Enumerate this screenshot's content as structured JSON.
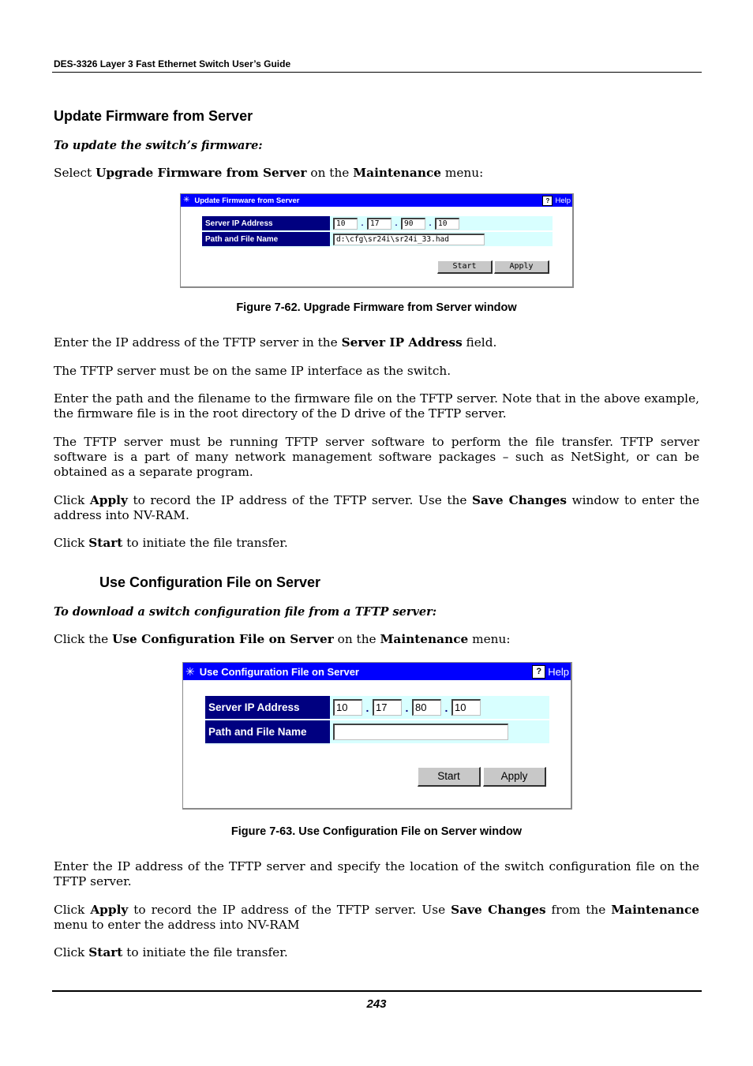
{
  "running_header": "DES-3326 Layer 3 Fast Ethernet Switch User’s Guide",
  "page_number": "243",
  "section1": {
    "heading": "Update Firmware from Server",
    "subheading": "To update the switch’s firmware:",
    "intro": {
      "p1": "Select ",
      "b1": "Upgrade Firmware from Server",
      "p2": " on the ",
      "b2": "Maintenance",
      "p3": " menu:"
    },
    "window": {
      "title": "Update Firmware from Server",
      "title_icon": "network-icon",
      "help_label": "Help",
      "help_icon": "question-icon",
      "rows": [
        {
          "label": "Server IP Address",
          "ip": [
            "10",
            "17",
            "90",
            "10"
          ]
        },
        {
          "label": "Path and File Name",
          "value": "d:\\cfg\\sr24i\\sr24i_33.had"
        }
      ],
      "ip_separator": ".",
      "buttons": {
        "start": "Start",
        "apply": "Apply"
      }
    },
    "caption": "Figure 7-62.  Upgrade Firmware from Server window",
    "paragraphs": {
      "a": {
        "p1": "Enter the IP address of the TFTP server in the ",
        "b1": "Server IP Address",
        "p2": " field."
      },
      "b": "The TFTP server must be on the same IP interface as the switch.",
      "c": "Enter the path and the filename to the firmware file on the TFTP server. Note that in the above example, the firmware file is in the root directory of the D drive of the TFTP server.",
      "d": "The TFTP server must be running TFTP server software to perform the file transfer. TFTP server software is a part of many network management software packages – such as NetSight, or can be obtained as a separate program.",
      "e": {
        "p1": "Click ",
        "b1": "Apply",
        "p2": " to record the IP address of the TFTP server. Use the ",
        "b2": "Save Changes",
        "p3": " window to enter the address into NV-RAM."
      },
      "f": {
        "p1": "Click ",
        "b1": "Start",
        "p2": " to initiate the file transfer."
      }
    }
  },
  "section2": {
    "heading": "Use Configuration File on Server",
    "subheading": "To download a switch configuration file from a TFTP server:",
    "intro": {
      "p1": "Click the ",
      "b1": "Use Configuration File on Server",
      "p2": " on the ",
      "b2": "Maintenance",
      "p3": " menu:"
    },
    "window": {
      "title": "Use Configuration File on Server",
      "title_icon": "network-icon",
      "help_label": "Help",
      "help_icon": "question-icon",
      "rows": [
        {
          "label": "Server IP Address",
          "ip": [
            "10",
            "17",
            "80",
            "10"
          ]
        },
        {
          "label": "Path and File Name",
          "value": ""
        }
      ],
      "ip_separator": ".",
      "buttons": {
        "start": "Start",
        "apply": "Apply"
      }
    },
    "caption": "Figure 7-63.  Use Configuration File on Server window",
    "paragraphs": {
      "a": "Enter the IP address of the TFTP server and specify the location of the switch configuration file on the TFTP server.",
      "b": {
        "p1": "Click ",
        "b1": "Apply",
        "p2": " to record the IP address of the TFTP server. Use ",
        "b2": "Save Changes",
        "p3": " from the ",
        "b3": "Maintenance",
        "p4": " menu to enter the address into NV-RAM"
      },
      "c": {
        "p1": "Click ",
        "b1": "Start",
        "p2": " to initiate the file transfer."
      }
    }
  }
}
